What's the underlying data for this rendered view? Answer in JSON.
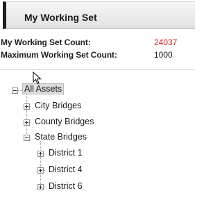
{
  "header": {
    "title": "My Working Set"
  },
  "stats": {
    "count_label": "My Working Set Count:",
    "count_value": "24037",
    "max_label": "Maximum Working Set Count:",
    "max_value": "1000"
  },
  "tree": {
    "root": {
      "label": "All Assets",
      "expanded": true,
      "selected": true
    },
    "children": [
      {
        "label": "City Bridges",
        "expanded": false
      },
      {
        "label": "County Bridges",
        "expanded": false
      },
      {
        "label": "State Bridges",
        "expanded": true,
        "children": [
          {
            "label": "District 1",
            "expanded": false
          },
          {
            "label": "District 4",
            "expanded": false
          },
          {
            "label": "District 6",
            "expanded": false
          }
        ]
      }
    ]
  },
  "colors": {
    "count_value": "#e02020",
    "header_accent": "#1e1e1e"
  },
  "icons": {
    "cursor": "mouse-pointer-icon",
    "expand": "plus-box-icon",
    "collapse": "minus-box-icon"
  }
}
